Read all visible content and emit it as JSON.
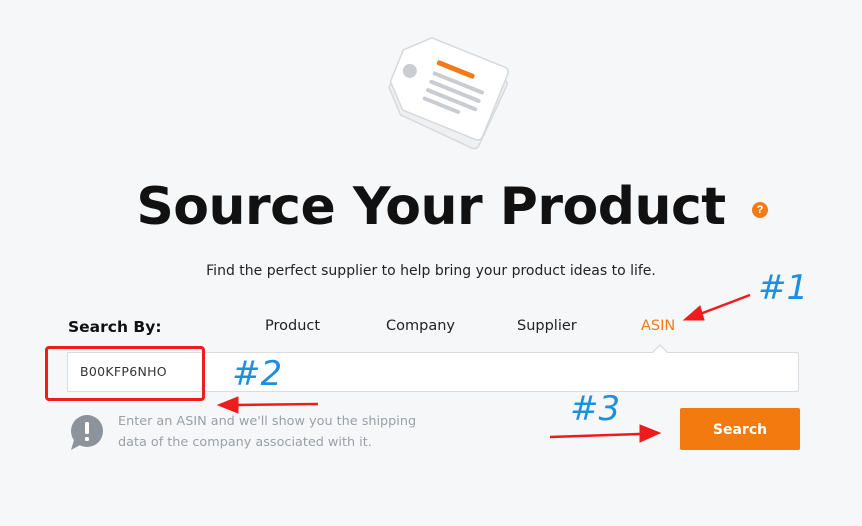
{
  "hero": {
    "icon": "price-tag-icon"
  },
  "page": {
    "title": "Source Your Product",
    "help_icon_label": "?",
    "subtitle": "Find the perfect supplier to help bring your product ideas to life."
  },
  "search": {
    "by_label": "Search By:",
    "tabs": [
      {
        "label": "Product",
        "active": false
      },
      {
        "label": "Company",
        "active": false
      },
      {
        "label": "Supplier",
        "active": false
      },
      {
        "label": "ASIN",
        "active": true
      }
    ],
    "input_value": "B00KFP6NHO",
    "hint": "Enter an ASIN and we'll show you the shipping data of the company associated with it.",
    "button_label": "Search"
  },
  "annotations": {
    "label_1": "#1",
    "label_2": "#2",
    "label_3": "#3"
  },
  "colors": {
    "accent": "#f07c19",
    "button": "#f37a0e",
    "annotation_red": "#ee1c1c",
    "annotation_blue": "#1e8fdf",
    "background": "#f6f7f9"
  }
}
